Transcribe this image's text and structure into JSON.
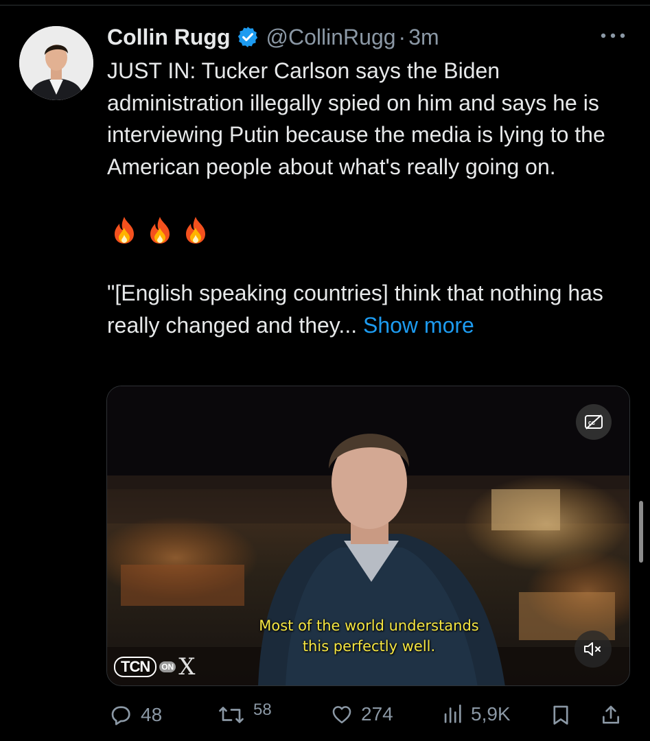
{
  "tweet": {
    "author_name": "Collin Rugg",
    "handle": "@CollinRugg",
    "separator": "·",
    "time": "3m",
    "text_paragraph_1": "JUST IN: Tucker Carlson says the Biden administration illegally spied on him and says he is interviewing Putin because the media is lying to the American people about what's really going on.",
    "emojis": [
      "🔥",
      "🔥",
      "🔥"
    ],
    "text_paragraph_2": "\"[English speaking countries] think that nothing has really changed and they...",
    "show_more_label": "Show more",
    "verified_color": "#1d9bf0"
  },
  "media": {
    "subtitle_line_1": "Most of the world understands",
    "subtitle_line_2": "this perfectly well.",
    "watermark_brand": "TCN",
    "watermark_on": "ON",
    "watermark_x": "X",
    "subtitle_color": "#f5e642"
  },
  "actions": {
    "replies": "48",
    "reposts": "58",
    "likes": "274",
    "views": "5,9K"
  },
  "colors": {
    "background": "#000000",
    "text": "#e7e9ea",
    "secondary": "#8b98a5",
    "link": "#1d9bf0"
  }
}
